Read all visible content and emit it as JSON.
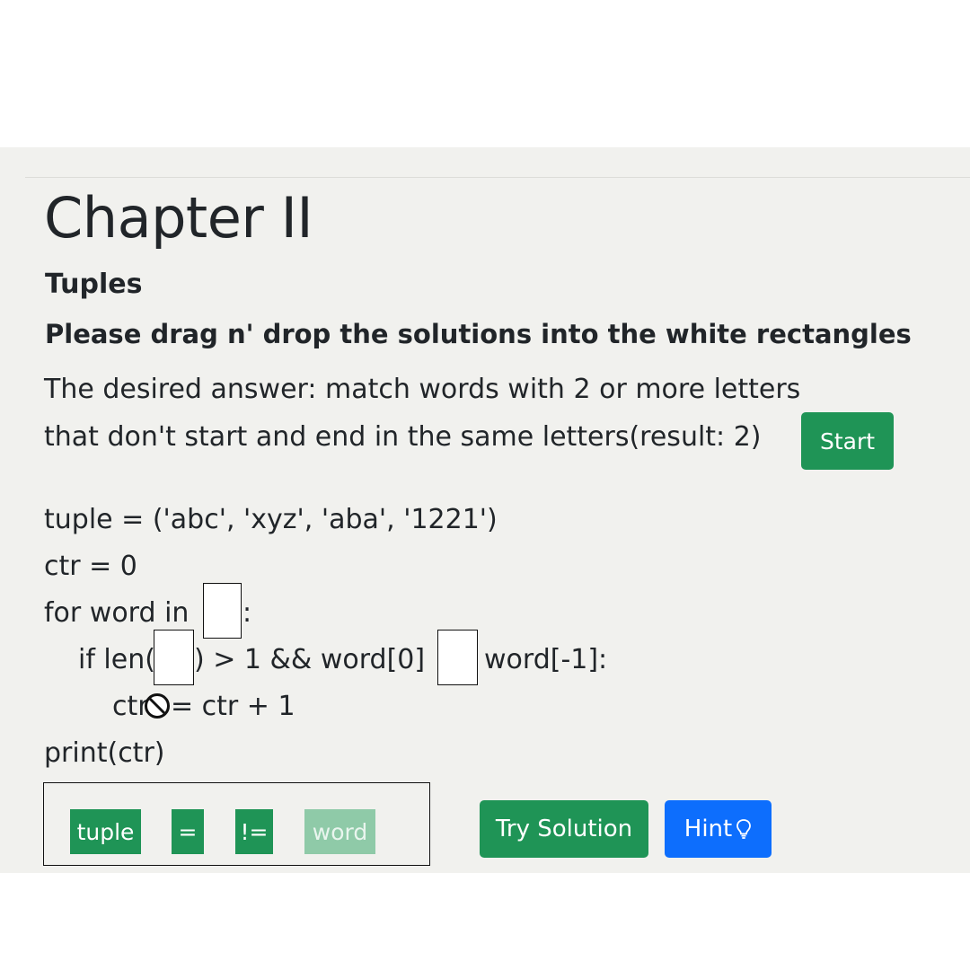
{
  "header": {
    "title": "Chapter II",
    "subtitle": "Tuples",
    "instruction": "Please drag n' drop the solutions into the white rectangles"
  },
  "task": {
    "line1": "The desired answer: match words with 2 or more letters",
    "line2": "that don't start and end in the same letters(result: 2)",
    "start_label": "Start"
  },
  "code": {
    "line1": "tuple = ('abc', 'xyz', 'aba', '1221')",
    "line2": "ctr = 0",
    "line3_before": "for word in",
    "line3_after": ":",
    "line4_before": "if len(",
    "line4_middle": ") > 1 && word[0]",
    "line4_after": "word[-1]:",
    "line5_before": "ctr",
    "line5_after": "= ctr + 1",
    "line6": "print(ctr)"
  },
  "solutions": {
    "tuple": "tuple",
    "eq": "=",
    "neq": "!=",
    "word": "word"
  },
  "actions": {
    "try_label": "Try Solution",
    "hint_label": "Hint"
  },
  "colors": {
    "green": "#1f9456",
    "blue": "#0d6efd",
    "faded_green": "#8fcaa8"
  }
}
